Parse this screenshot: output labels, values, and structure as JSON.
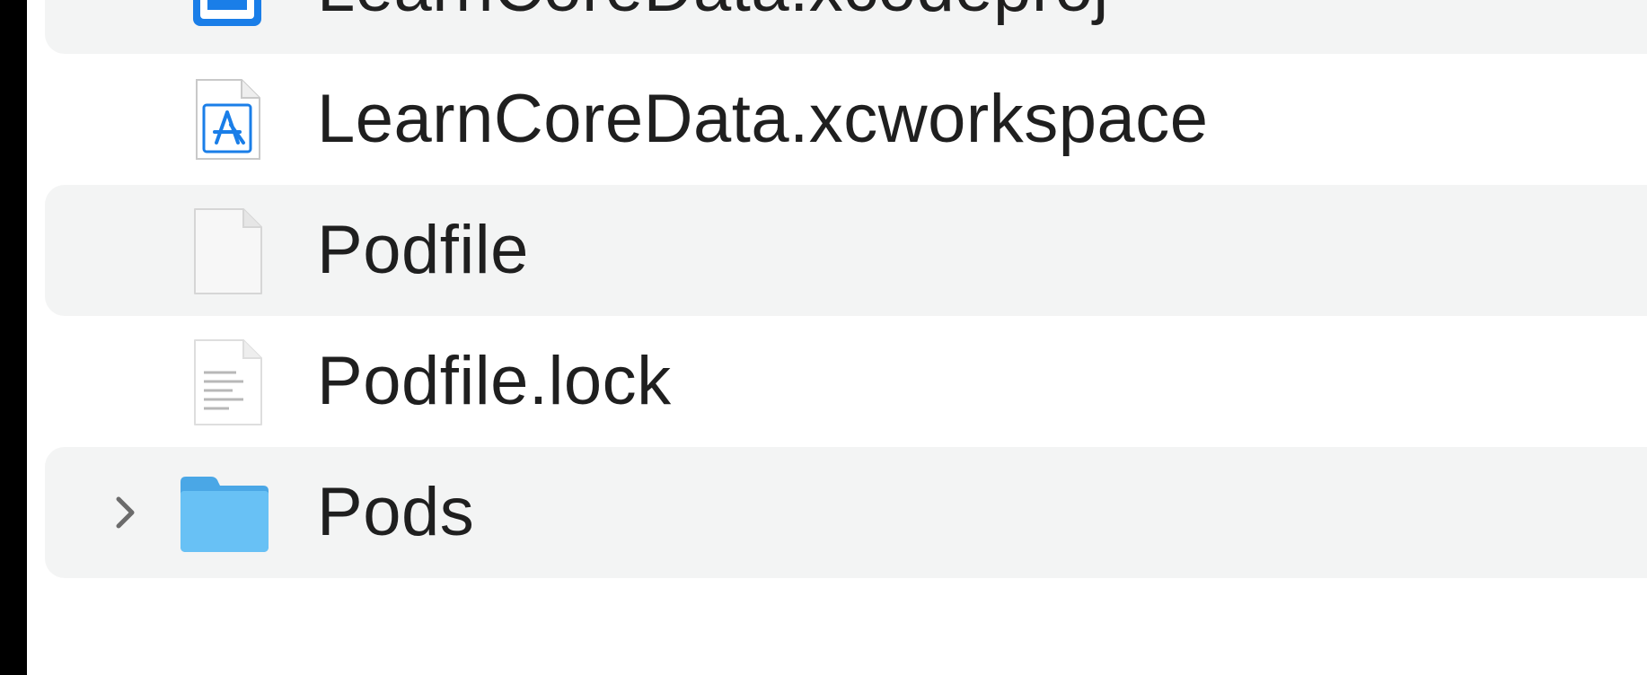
{
  "finder": {
    "files": [
      {
        "name": "LearnCoreData.xcodeproj",
        "icon": "xcode-project-icon",
        "kind": "project",
        "striped": true
      },
      {
        "name": "LearnCoreData.xcworkspace",
        "icon": "xcode-workspace-icon",
        "kind": "workspace",
        "striped": false
      },
      {
        "name": "Podfile",
        "icon": "blank-document-icon",
        "kind": "file",
        "striped": true
      },
      {
        "name": "Podfile.lock",
        "icon": "text-document-icon",
        "kind": "text",
        "striped": false
      },
      {
        "name": "Pods",
        "icon": "folder-icon",
        "kind": "folder",
        "striped": true,
        "expandable": true,
        "expanded": false
      }
    ]
  },
  "colors": {
    "stripe": "#f3f4f4",
    "text": "#1f1f1f",
    "folder_blue": "#55b6f0",
    "xcode_blue": "#1a7ee8"
  }
}
